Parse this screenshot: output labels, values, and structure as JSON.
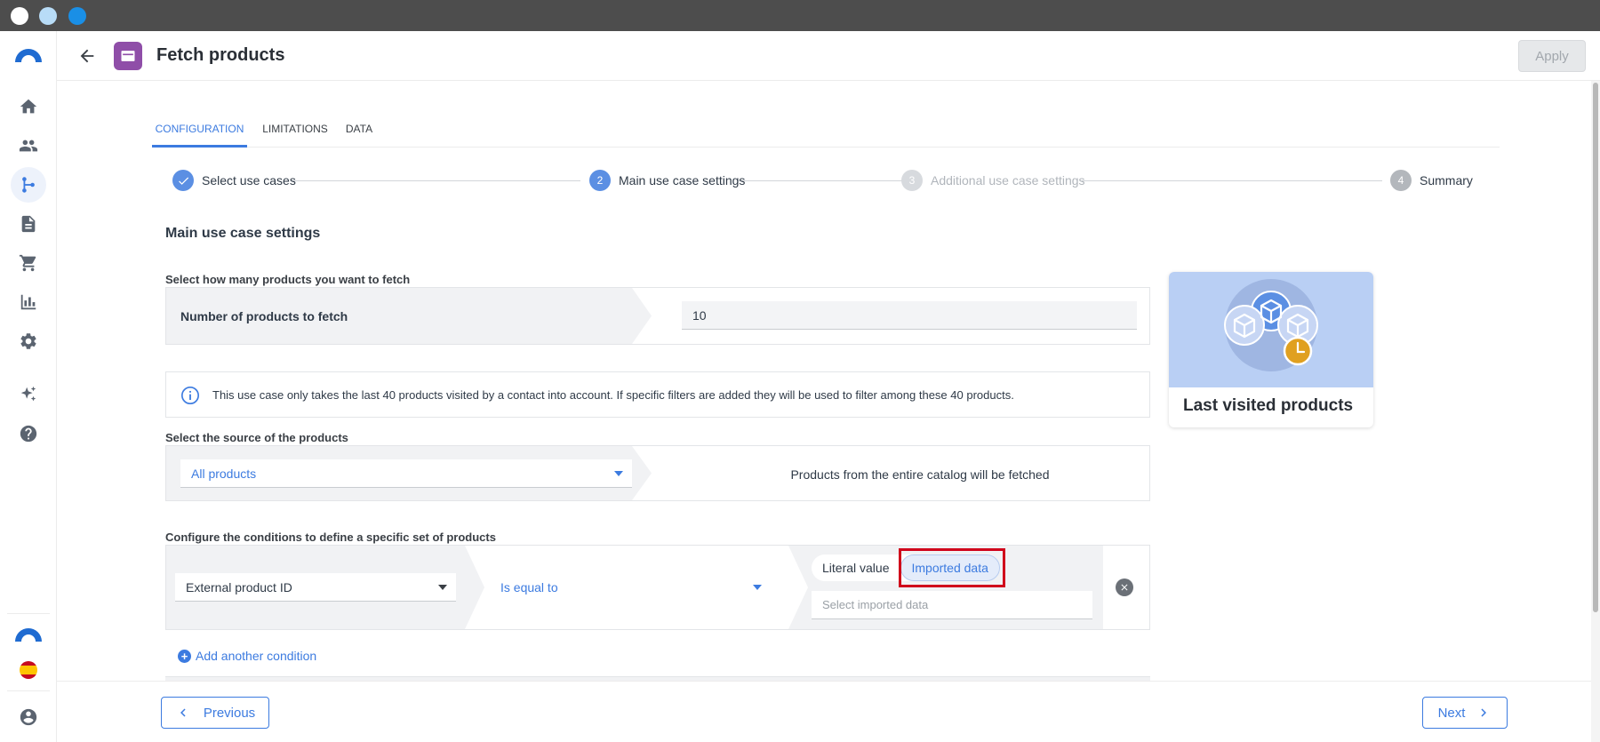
{
  "header": {
    "title": "Fetch products",
    "apply_label": "Apply"
  },
  "sidebar": {
    "items": [
      {
        "icon": "home-icon"
      },
      {
        "icon": "contacts-icon"
      },
      {
        "icon": "workflow-icon",
        "active": true
      },
      {
        "icon": "document-icon"
      },
      {
        "icon": "cart-icon"
      },
      {
        "icon": "bar-chart-icon"
      },
      {
        "icon": "gear-icon"
      },
      {
        "icon": "sparkle-icon"
      },
      {
        "icon": "help-icon"
      }
    ]
  },
  "tabs": [
    {
      "label": "CONFIGURATION",
      "active": true
    },
    {
      "label": "LIMITATIONS"
    },
    {
      "label": "DATA"
    }
  ],
  "stepper": {
    "steps": [
      {
        "number": "",
        "label": "Select use cases",
        "state": "done"
      },
      {
        "number": "2",
        "label": "Main use case settings",
        "state": "current"
      },
      {
        "number": "3",
        "label": "Additional use case settings",
        "state": "pending"
      },
      {
        "number": "4",
        "label": "Summary",
        "state": "pending"
      }
    ]
  },
  "main": {
    "section_title": "Main use case settings",
    "count": {
      "label": "Select how many products you want to fetch",
      "field_label": "Number of products to fetch",
      "value": "10"
    },
    "info_text": "This use case only takes the last 40 products visited by a contact into account. If specific filters are added they will be used to filter among these 40 products.",
    "source": {
      "label": "Select the source of the products",
      "selected": "All products",
      "description": "Products from the entire catalog will be fetched"
    },
    "conditions": {
      "label": "Configure the conditions to define a specific set of products",
      "field": "External product ID",
      "operator": "Is equal to",
      "toggle_literal": "Literal value",
      "toggle_imported": "Imported data",
      "imported_placeholder": "Select imported data",
      "add_label": "Add another condition"
    }
  },
  "card": {
    "title": "Last visited products"
  },
  "footer": {
    "previous_label": "Previous",
    "next_label": "Next"
  },
  "colors": {
    "accent": "#3c7be0",
    "highlight": "#d0021b",
    "app_badge": "#8f4ea8"
  }
}
